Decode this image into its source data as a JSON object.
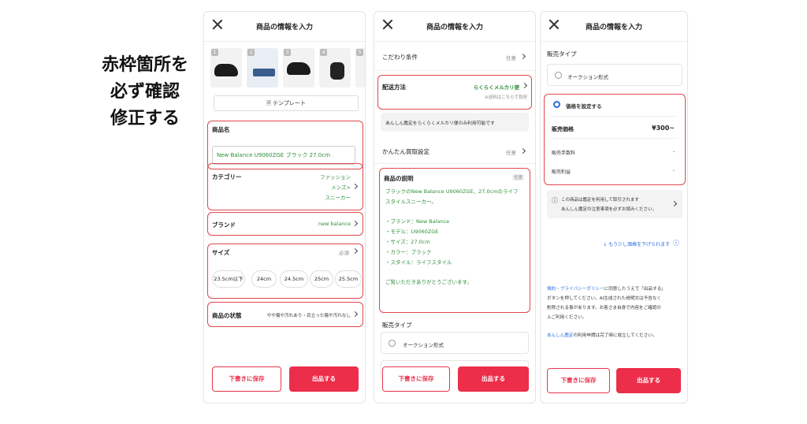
{
  "caption": [
    "赤枠箇所を",
    "必ず確認",
    "修正する"
  ],
  "screens": {
    "title": "商品の情報を入力",
    "s1": {
      "thumb_numbers": [
        "1",
        "2",
        "3",
        "4",
        "5"
      ],
      "template_button": "テンプレート",
      "name_label": "商品名",
      "name_value": "New Balance U9060ZGE ブラック 27.0cm",
      "category_label": "カテゴリー",
      "category_values": [
        "ファッション",
        "メンズ>",
        "スニーカー"
      ],
      "brand_label": "ブランド",
      "brand_value": "new balance",
      "size_label": "サイズ",
      "size_required": "必須",
      "size_chips": [
        "23.5cm以下",
        "24cm",
        "24.5cm",
        "25cm",
        "25.5cm"
      ],
      "condition_label": "商品の状態",
      "condition_value": "やや傷や汚れあり・目立った傷や汚れなし",
      "condition_value_display": "目立った傷や汚れなし",
      "condition_value_full": "目立った傷や汚れなし"
    },
    "s1_condition": "やや傷や汚れあり",
    "s1_condition_text": "目立った傷や汚れなし",
    "s1_condition_line": "目立った傷や汚れなし",
    "s2": {
      "kodawari_label": "こだわり条件",
      "kodawari_opt": "任意",
      "shipping_label": "配送方法",
      "shipping_value": "らくらくメルカリ便",
      "shipping_note": "※送料はこちらで負担",
      "info_box": "あんしん鑑定をらくらくメルカリ便のみ利用可能です",
      "kantei_label": "かんたん買取設定",
      "kantei_opt": "任意",
      "desc_label": "商品の説明",
      "desc_tag": "任意",
      "desc_lines": [
        "ブラックのNew Balance U9060ZGE、27.0cmのライフ",
        "スタイルスニーカー。",
        "",
        "・ブランド：New Balance",
        "・モデル：U9060ZGE",
        "・サイズ：27.0cm",
        "・カラー：ブラック",
        "・スタイル：ライフスタイル",
        "",
        "ご覧いただきありがとうございます。"
      ],
      "sale_type_label": "販売タイプ",
      "auction_label": "オークション形式"
    },
    "s3": {
      "sale_type_label": "販売タイプ",
      "auction_label": "オークション形式",
      "fixed_label": "価格を設定する",
      "price_label": "販売価格",
      "price_value": "¥300~",
      "fee_label": "販売手数料",
      "fee_value": "-",
      "profit_label": "販売利益",
      "profit_value": "-",
      "notice_line1": "この商品は鑑定を利用して取引されます",
      "notice_line2": "あんしん鑑定の注意事項を必ずお読みください。",
      "lower_price_link": "↓ もう少し価格を下げられます",
      "terms_link": "規約・プライバシーポリシー",
      "terms_lines": [
        "に同意したうえで「出品する」",
        "ボタンを押してください。AI生成された説明文は予告なく",
        "削除される事があります。お客さま自身で内容をご確認の",
        "上ご利用ください。"
      ],
      "kantei_link": "あんしん鑑定",
      "kantei_text": "の利用申請は完了時に成立してください。"
    },
    "buttons": {
      "draft": "下書きに保存",
      "submit": "出品する"
    }
  },
  "colors": {
    "highlight": "#e0474c",
    "accent": "#ec2e4b",
    "green_text": "#2f8f3a",
    "link_blue": "#2a6de0"
  }
}
